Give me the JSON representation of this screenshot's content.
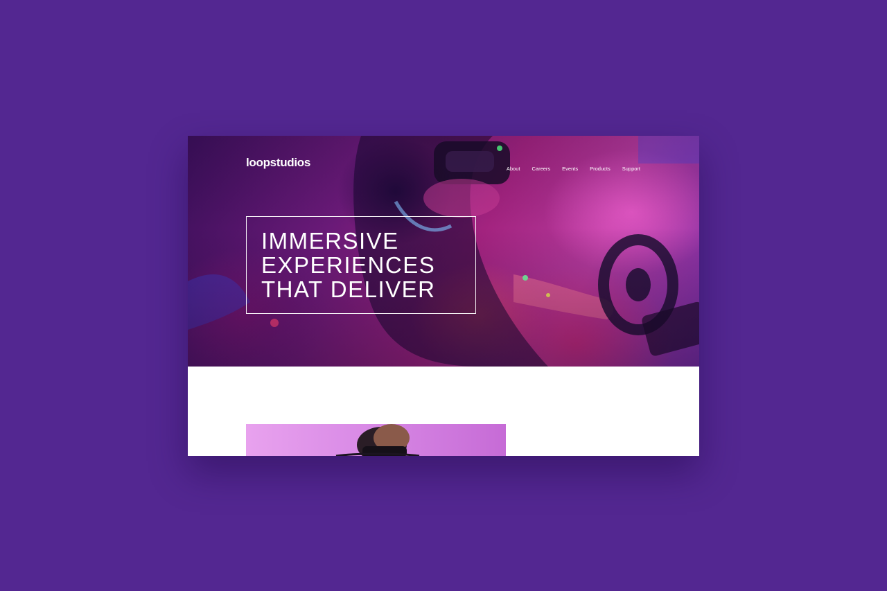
{
  "brand": {
    "logo_text": "loopstudios"
  },
  "nav": {
    "items": [
      {
        "label": "About"
      },
      {
        "label": "Careers"
      },
      {
        "label": "Events"
      },
      {
        "label": "Products"
      },
      {
        "label": "Support"
      }
    ]
  },
  "hero": {
    "headline_lines": [
      "IMMERSIVE",
      "EXPERIENCES",
      "THAT DELIVER"
    ],
    "image": "vr-racing-gamer-photo"
  },
  "section": {
    "feature_image": "vr-headset-person-photo"
  },
  "colors": {
    "page_background": "#532791",
    "hero_tint": "#a3237f",
    "text": "#ffffff",
    "feature_image_tint": "#d98ae6"
  }
}
